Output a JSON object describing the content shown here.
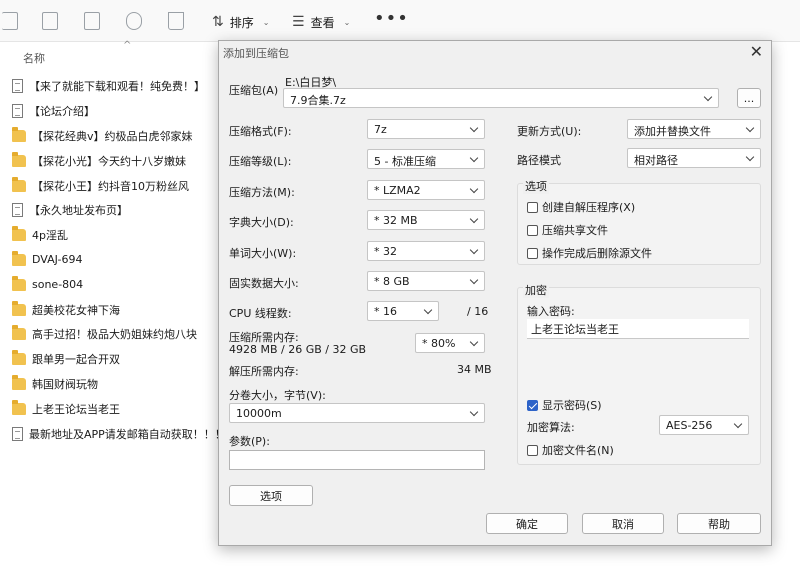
{
  "toolbar": {
    "sort_label": "排序",
    "view_label": "查看",
    "more_label": "•••"
  },
  "file_list": {
    "column_name": "名称",
    "files": [
      {
        "name": "【来了就能下载和观看！纯免费！】",
        "type": "doc"
      },
      {
        "name": "【论坛介绍】",
        "type": "doc"
      },
      {
        "name": "【探花经典v】约极品白虎邻家妹",
        "type": "folder"
      },
      {
        "name": "【探花小光】今天约十八岁嫩妹",
        "type": "folder"
      },
      {
        "name": "【探花小王】约抖音10万粉丝风",
        "type": "folder"
      },
      {
        "name": "【永久地址发布页】",
        "type": "doc"
      },
      {
        "name": "4p淫乱",
        "type": "folder"
      },
      {
        "name": "DVAJ-694",
        "type": "folder"
      },
      {
        "name": "sone-804",
        "type": "folder"
      },
      {
        "name": "超美校花女神下海",
        "type": "folder"
      },
      {
        "name": "高手过招！极品大奶姐妹约炮八块",
        "type": "folder"
      },
      {
        "name": "跟单男一起合开双",
        "type": "folder"
      },
      {
        "name": "韩国财阀玩物",
        "type": "folder"
      },
      {
        "name": "上老王论坛当老王",
        "type": "folder"
      },
      {
        "name": "最新地址及APP请发邮箱自动获取！！！",
        "type": "doc"
      }
    ]
  },
  "dialog": {
    "title": "添加到压缩包",
    "close": "✕",
    "archive_label": "压缩包(A)",
    "archive_path": "E:\\白日梦\\",
    "archive_name": "7.9合集.7z",
    "browse": "...",
    "format_label": "压缩格式(F):",
    "format_value": "7z",
    "level_label": "压缩等级(L):",
    "level_value": "5 - 标准压缩",
    "method_label": "压缩方法(M):",
    "method_value": "* LZMA2",
    "dict_label": "字典大小(D):",
    "dict_value": "* 32 MB",
    "word_label": "单词大小(W):",
    "word_value": "* 32",
    "solid_label": "固实数据大小:",
    "solid_value": "* 8 GB",
    "cpu_label": "CPU 线程数:",
    "cpu_value": "* 16",
    "cpu_total": "/ 16",
    "mem_comp_label": "压缩所需内存:",
    "mem_comp_value": "4928 MB / 26 GB / 32 GB",
    "mem_percent": "* 80%",
    "mem_decomp_label": "解压所需内存:",
    "mem_decomp_value": "34 MB",
    "volume_label": "分卷大小，字节(V):",
    "volume_value": "10000m",
    "params_label": "参数(P):",
    "params_value": "",
    "options_button": "选项",
    "update_label": "更新方式(U):",
    "update_value": "添加并替换文件",
    "pathmode_label": "路径模式",
    "pathmode_value": "相对路径",
    "options_group": "选项",
    "opt_sfx": "创建自解压程序(X)",
    "opt_shared": "压缩共享文件",
    "opt_delete": "操作完成后删除源文件",
    "encrypt_group": "加密",
    "password_label": "输入密码:",
    "password_value": "上老王论坛当老王",
    "show_password": "显示密码(S)",
    "enc_method_label": "加密算法:",
    "enc_method_value": "AES-256",
    "encrypt_names": "加密文件名(N)",
    "ok": "确定",
    "cancel": "取消",
    "help": "帮助"
  }
}
